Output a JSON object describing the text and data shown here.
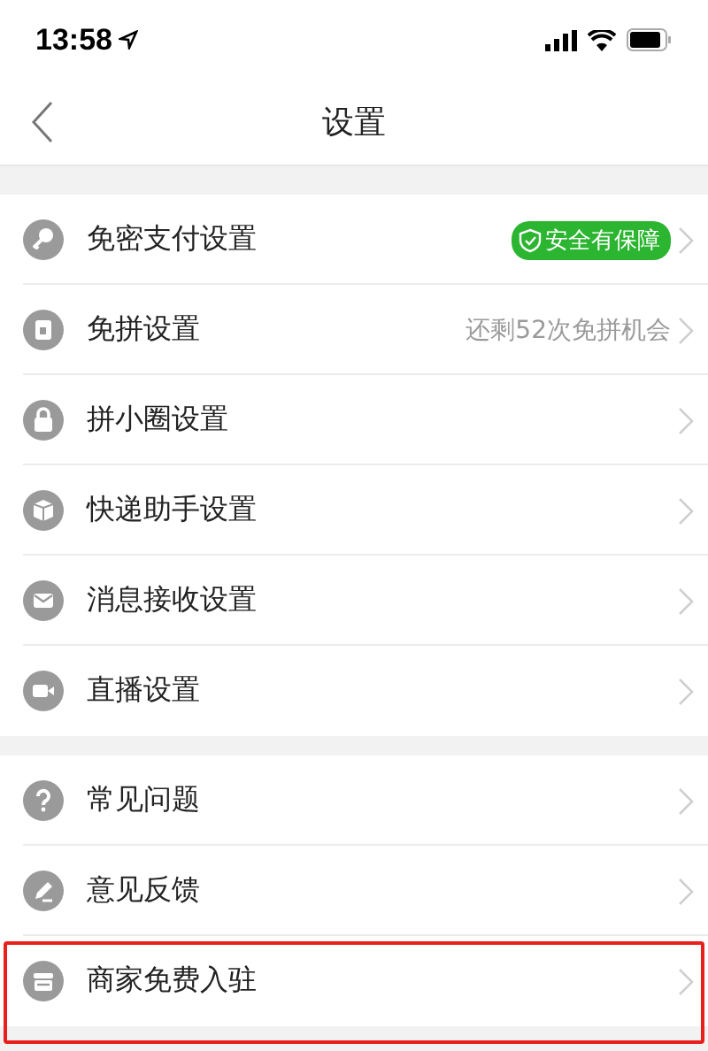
{
  "status_bar": {
    "time": "13:58"
  },
  "nav": {
    "title": "设置"
  },
  "groups": [
    {
      "items": [
        {
          "label": "免密支付设置",
          "detail": {
            "kind": "badge",
            "text": "安全有保障"
          },
          "highlighted": false
        },
        {
          "label": "免拼设置",
          "detail": {
            "kind": "text",
            "text": "还剩52次免拼机会"
          },
          "highlighted": false
        },
        {
          "label": "拼小圈设置",
          "highlighted": false
        },
        {
          "label": "快递助手设置",
          "highlighted": false
        },
        {
          "label": "消息接收设置",
          "highlighted": false
        },
        {
          "label": "直播设置",
          "highlighted": false
        }
      ]
    },
    {
      "items": [
        {
          "label": "常见问题",
          "highlighted": false
        },
        {
          "label": "意见反馈",
          "highlighted": false
        },
        {
          "label": "商家免费入驻",
          "highlighted": true
        }
      ]
    }
  ]
}
